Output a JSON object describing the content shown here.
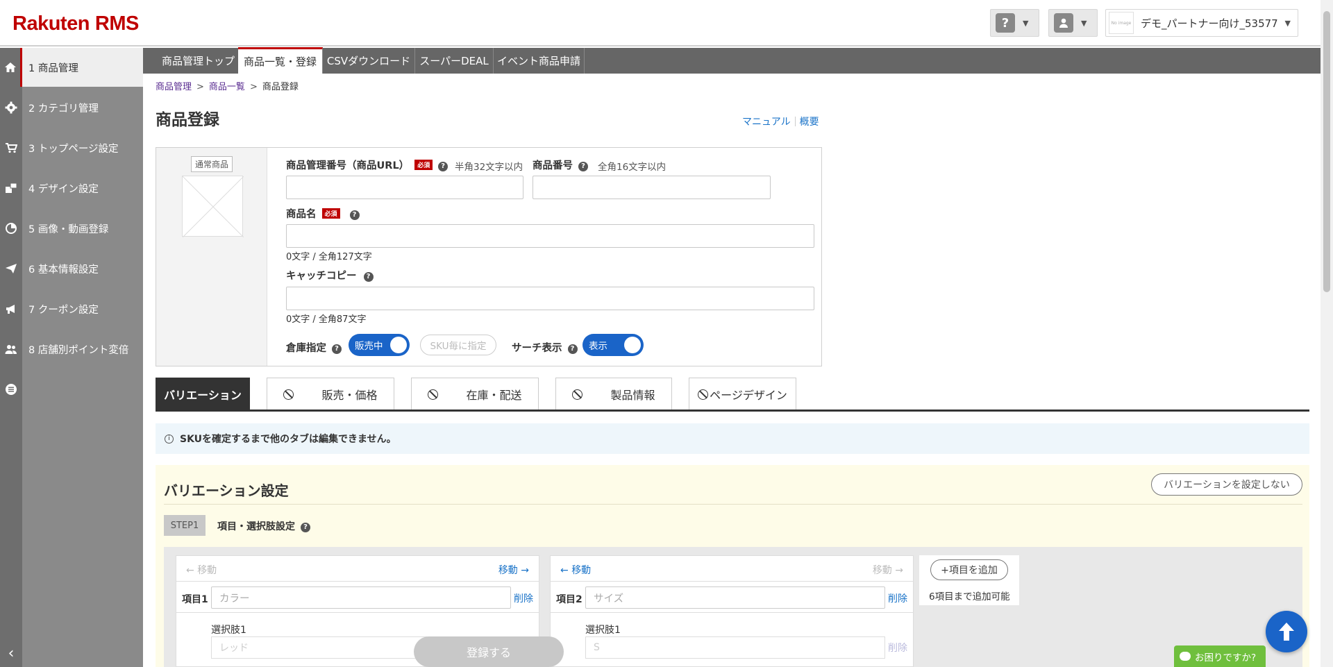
{
  "app": {
    "logo_main": "Rakuten",
    "logo_sub": "RMS"
  },
  "header": {
    "help_icon": "?",
    "shop_thumb": "No image",
    "shop_name": "デモ_パートナー向け_53577"
  },
  "sidebar": {
    "items": [
      {
        "label": "1 商品管理",
        "icon": "home-icon"
      },
      {
        "label": "2 カテゴリ管理",
        "icon": "gear-icon"
      },
      {
        "label": "3 トップページ設定",
        "icon": "cart-icon"
      },
      {
        "label": "4 デザイン設定",
        "icon": "design-icon"
      },
      {
        "label": "5 画像・動画登録",
        "icon": "chart-icon"
      },
      {
        "label": "6 基本情報設定",
        "icon": "send-icon"
      },
      {
        "label": "7 クーポン設定",
        "icon": "megaphone-icon"
      },
      {
        "label": "8 店舗別ポイント変倍",
        "icon": "users-icon"
      }
    ],
    "collapse": "‹"
  },
  "navtabs": [
    {
      "label": "商品管理トップ"
    },
    {
      "label": "商品一覧・登録"
    },
    {
      "label": "CSVダウンロード"
    },
    {
      "label": "スーパーDEAL"
    },
    {
      "label": "イベント商品申請"
    }
  ],
  "breadcrumb": {
    "c1": "商品管理",
    "c2": "商品一覧",
    "c3": "商品登録",
    "sep": ">"
  },
  "page": {
    "title": "商品登録",
    "link_manual": "マニュアル",
    "link_summary": "概要"
  },
  "product": {
    "type_badge": "通常商品",
    "mgmt_no_label": "商品管理番号（商品URL）",
    "required": "必須",
    "mgmt_no_hint": "半角32文字以内",
    "item_no_label": "商品番号",
    "item_no_hint": "全角16文字以内",
    "name_label": "商品名",
    "name_count": "0文字 / 全角127文字",
    "catch_label": "キャッチコピー",
    "catch_count": "0文字 / 全角87文字",
    "warehouse_label": "倉庫指定",
    "warehouse_toggle": "販売中",
    "sku_pill": "SKU毎に指定",
    "search_label": "サーチ表示",
    "search_toggle": "表示"
  },
  "maintabs": [
    {
      "label": "バリエーション"
    },
    {
      "label": "販売・価格"
    },
    {
      "label": "在庫・配送"
    },
    {
      "label": "製品情報"
    },
    {
      "label": "ページデザイン"
    }
  ],
  "info": {
    "text": "SKUを確定するまで他のタブは編集できません。"
  },
  "variation": {
    "title": "バリエーション設定",
    "no_var_button": "バリエーションを設定しない",
    "step": "STEP1",
    "step_label": "項目・選択肢設定",
    "move": "移動",
    "item1_label": "項目1",
    "item1_placeholder": "カラー",
    "item2_label": "項目2",
    "item2_placeholder": "サイズ",
    "delete": "削除",
    "choice_label": "選択肢1",
    "choice1_placeholder": "レッド",
    "choice2_placeholder": "S",
    "add_item": "+項目を追加",
    "add_note": "6項目まで追加可能"
  },
  "footer": {
    "register": "登録する",
    "help": "お困りですか?"
  },
  "colors": {
    "brand": "#bf0000",
    "accent": "#1a64c8",
    "link": "#1a73c8"
  }
}
